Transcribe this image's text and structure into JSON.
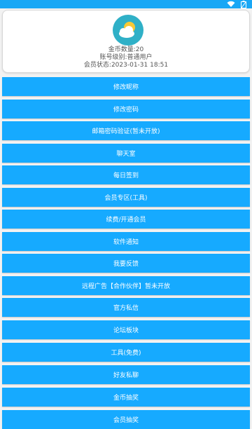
{
  "status_bar": {
    "icons": [
      "wifi-icon",
      "battery-icon"
    ]
  },
  "profile": {
    "avatar_icon": "weather-cloud-sun-icon",
    "coins_line": "金币数量:20",
    "account_level_line": "账号级别:普通用户",
    "member_status_line": "会员状态:2023-01-31 18:51"
  },
  "menu": {
    "items": [
      {
        "label": "修改昵称"
      },
      {
        "label": "修改密码"
      },
      {
        "label": "邮箱密码验证(暂未开放)"
      },
      {
        "label": "聊天室"
      },
      {
        "label": "每日签到"
      },
      {
        "label": "会员专区(工具)"
      },
      {
        "label": "续费/开通会员"
      },
      {
        "label": "软件通知"
      },
      {
        "label": "我要反馈"
      },
      {
        "label": "远程广告【合作伙伴】暂未开放"
      },
      {
        "label": "官方私信"
      },
      {
        "label": "论坛板块"
      },
      {
        "label": "工具(免费)"
      },
      {
        "label": "好友私聊"
      },
      {
        "label": "金币抽奖"
      },
      {
        "label": "会员抽奖"
      }
    ]
  },
  "colors": {
    "accent": "#16aaff",
    "status_bar": "#19a7f5",
    "avatar_bg": "#2fb0c7"
  }
}
